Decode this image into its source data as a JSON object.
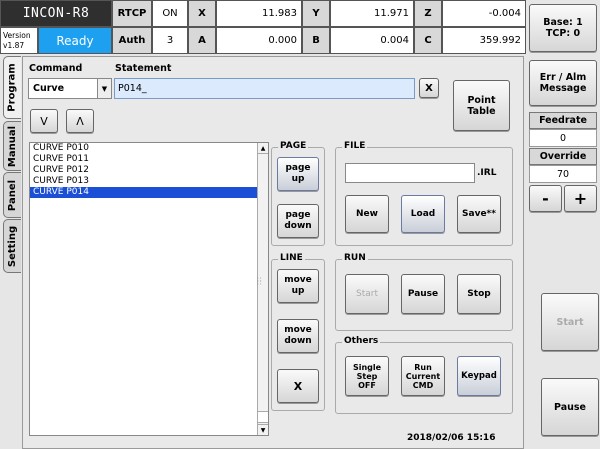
{
  "header": {
    "title": "INCON-R8",
    "version_label": "Version",
    "version": "v1.87",
    "status": "Ready",
    "rtcp_label": "RTCP",
    "rtcp_value": "ON",
    "auth_label": "Auth",
    "auth_value": "3",
    "axes": [
      {
        "label": "X",
        "value": "11.983"
      },
      {
        "label": "Y",
        "value": "11.971"
      },
      {
        "label": "Z",
        "value": "-0.004"
      },
      {
        "label": "A",
        "value": "0.000"
      },
      {
        "label": "B",
        "value": "0.004"
      },
      {
        "label": "C",
        "value": "359.992"
      }
    ]
  },
  "side": {
    "base_tcp_line1": "Base: 1",
    "base_tcp_line2": "TCP: 0",
    "err_alm_line1": "Err / Alm",
    "err_alm_line2": "Message",
    "feedrate_label": "Feedrate",
    "feedrate_value": "0",
    "override_label": "Override",
    "override_value": "70",
    "minus": "-",
    "plus": "+",
    "start": "Start",
    "pause": "Pause"
  },
  "tabs": [
    "Program",
    "Manual",
    "Panel",
    "Setting"
  ],
  "program": {
    "command_label": "Command",
    "command_value": "Curve",
    "statement_label": "Statement",
    "statement_value": "P014_",
    "clear": "X",
    "point_table_line1": "Point",
    "point_table_line2": "Table",
    "down_arrow": "V",
    "up_arrow": "Λ",
    "list": [
      "CURVE P010",
      "CURVE P011",
      "CURVE P012",
      "CURVE P013",
      "CURVE P014"
    ],
    "selected_index": 4,
    "scroll_up": "▲",
    "scroll_down": "▼"
  },
  "page": {
    "title": "PAGE",
    "up_line1": "page",
    "up_line2": "up",
    "down_line1": "page",
    "down_line2": "down"
  },
  "line": {
    "title": "LINE",
    "up_line1": "move",
    "up_line2": "up",
    "down_line1": "move",
    "down_line2": "down",
    "delete": "X"
  },
  "file": {
    "title": "FILE",
    "filename": "",
    "ext": ".IRL",
    "new": "New",
    "load": "Load",
    "save": "Save**"
  },
  "run": {
    "title": "RUN",
    "start": "Start",
    "pause": "Pause",
    "stop": "Stop"
  },
  "others": {
    "title": "Others",
    "single_line1": "Single",
    "single_line2": "Step",
    "single_line3": "OFF",
    "run_line1": "Run",
    "run_line2": "Current",
    "run_line3": "CMD",
    "keypad": "Keypad"
  },
  "datetime": "2018/02/06 15:16"
}
